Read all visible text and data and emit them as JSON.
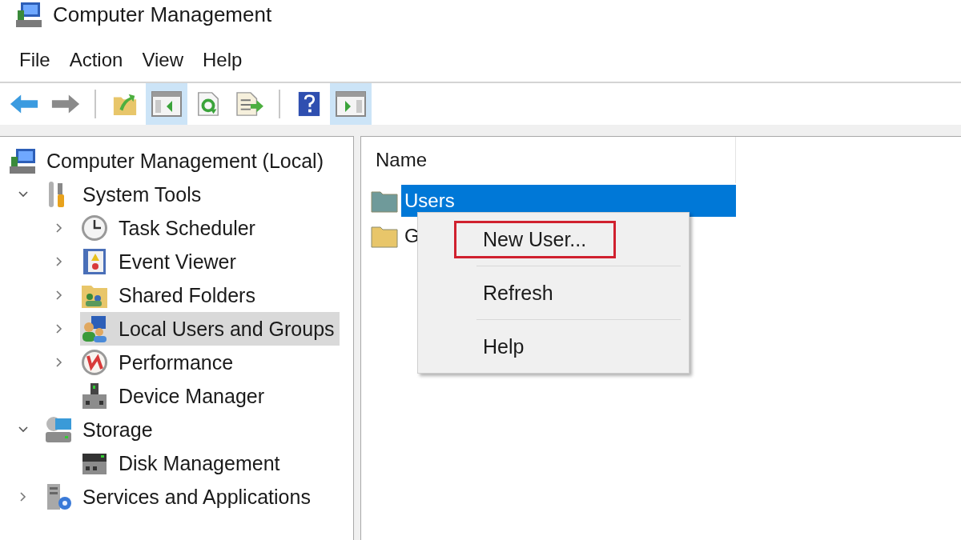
{
  "window": {
    "title": "Computer Management"
  },
  "menu": [
    "File",
    "Action",
    "View",
    "Help"
  ],
  "toolbar": [
    {
      "kind": "back",
      "pressed": false
    },
    {
      "kind": "forward",
      "pressed": false
    },
    {
      "kind": "separator"
    },
    {
      "kind": "up",
      "pressed": false
    },
    {
      "kind": "tree-pane",
      "pressed": true
    },
    {
      "kind": "refresh",
      "pressed": false
    },
    {
      "kind": "export",
      "pressed": false
    },
    {
      "kind": "separator"
    },
    {
      "kind": "help",
      "pressed": false
    },
    {
      "kind": "action-pane",
      "pressed": true
    }
  ],
  "tree": [
    {
      "label": "Computer Management (Local)",
      "kind": "root",
      "selected": false,
      "children": [
        {
          "label": "System Tools",
          "kind": "expandable",
          "expanded": true,
          "selected": false,
          "children": [
            {
              "label": "Task Scheduler",
              "kind": "expandable",
              "expanded": false,
              "selected": false
            },
            {
              "label": "Event Viewer",
              "kind": "expandable",
              "expanded": false,
              "selected": false
            },
            {
              "label": "Shared Folders",
              "kind": "expandable",
              "expanded": false,
              "selected": false
            },
            {
              "label": "Local Users and Groups",
              "kind": "expandable",
              "expanded": false,
              "selected": true
            },
            {
              "label": "Performance",
              "kind": "expandable",
              "expanded": false,
              "selected": false
            },
            {
              "label": "Device Manager",
              "kind": "leaf",
              "selected": false
            }
          ]
        },
        {
          "label": "Storage",
          "kind": "expandable",
          "expanded": true,
          "selected": false,
          "children": [
            {
              "label": "Disk Management",
              "kind": "leaf",
              "selected": false
            }
          ]
        },
        {
          "label": "Services and Applications",
          "kind": "expandable",
          "expanded": false,
          "selected": false
        }
      ]
    }
  ],
  "list": {
    "columns": [
      "Name"
    ],
    "rows": [
      {
        "name": "Users",
        "selected": true
      },
      {
        "name": "G",
        "selected": false
      }
    ]
  },
  "context_menu": {
    "items": [
      {
        "label": "New User...",
        "highlighted": true
      },
      {
        "label": "Refresh",
        "highlighted": false
      },
      {
        "label": "Help",
        "highlighted": false
      }
    ]
  }
}
